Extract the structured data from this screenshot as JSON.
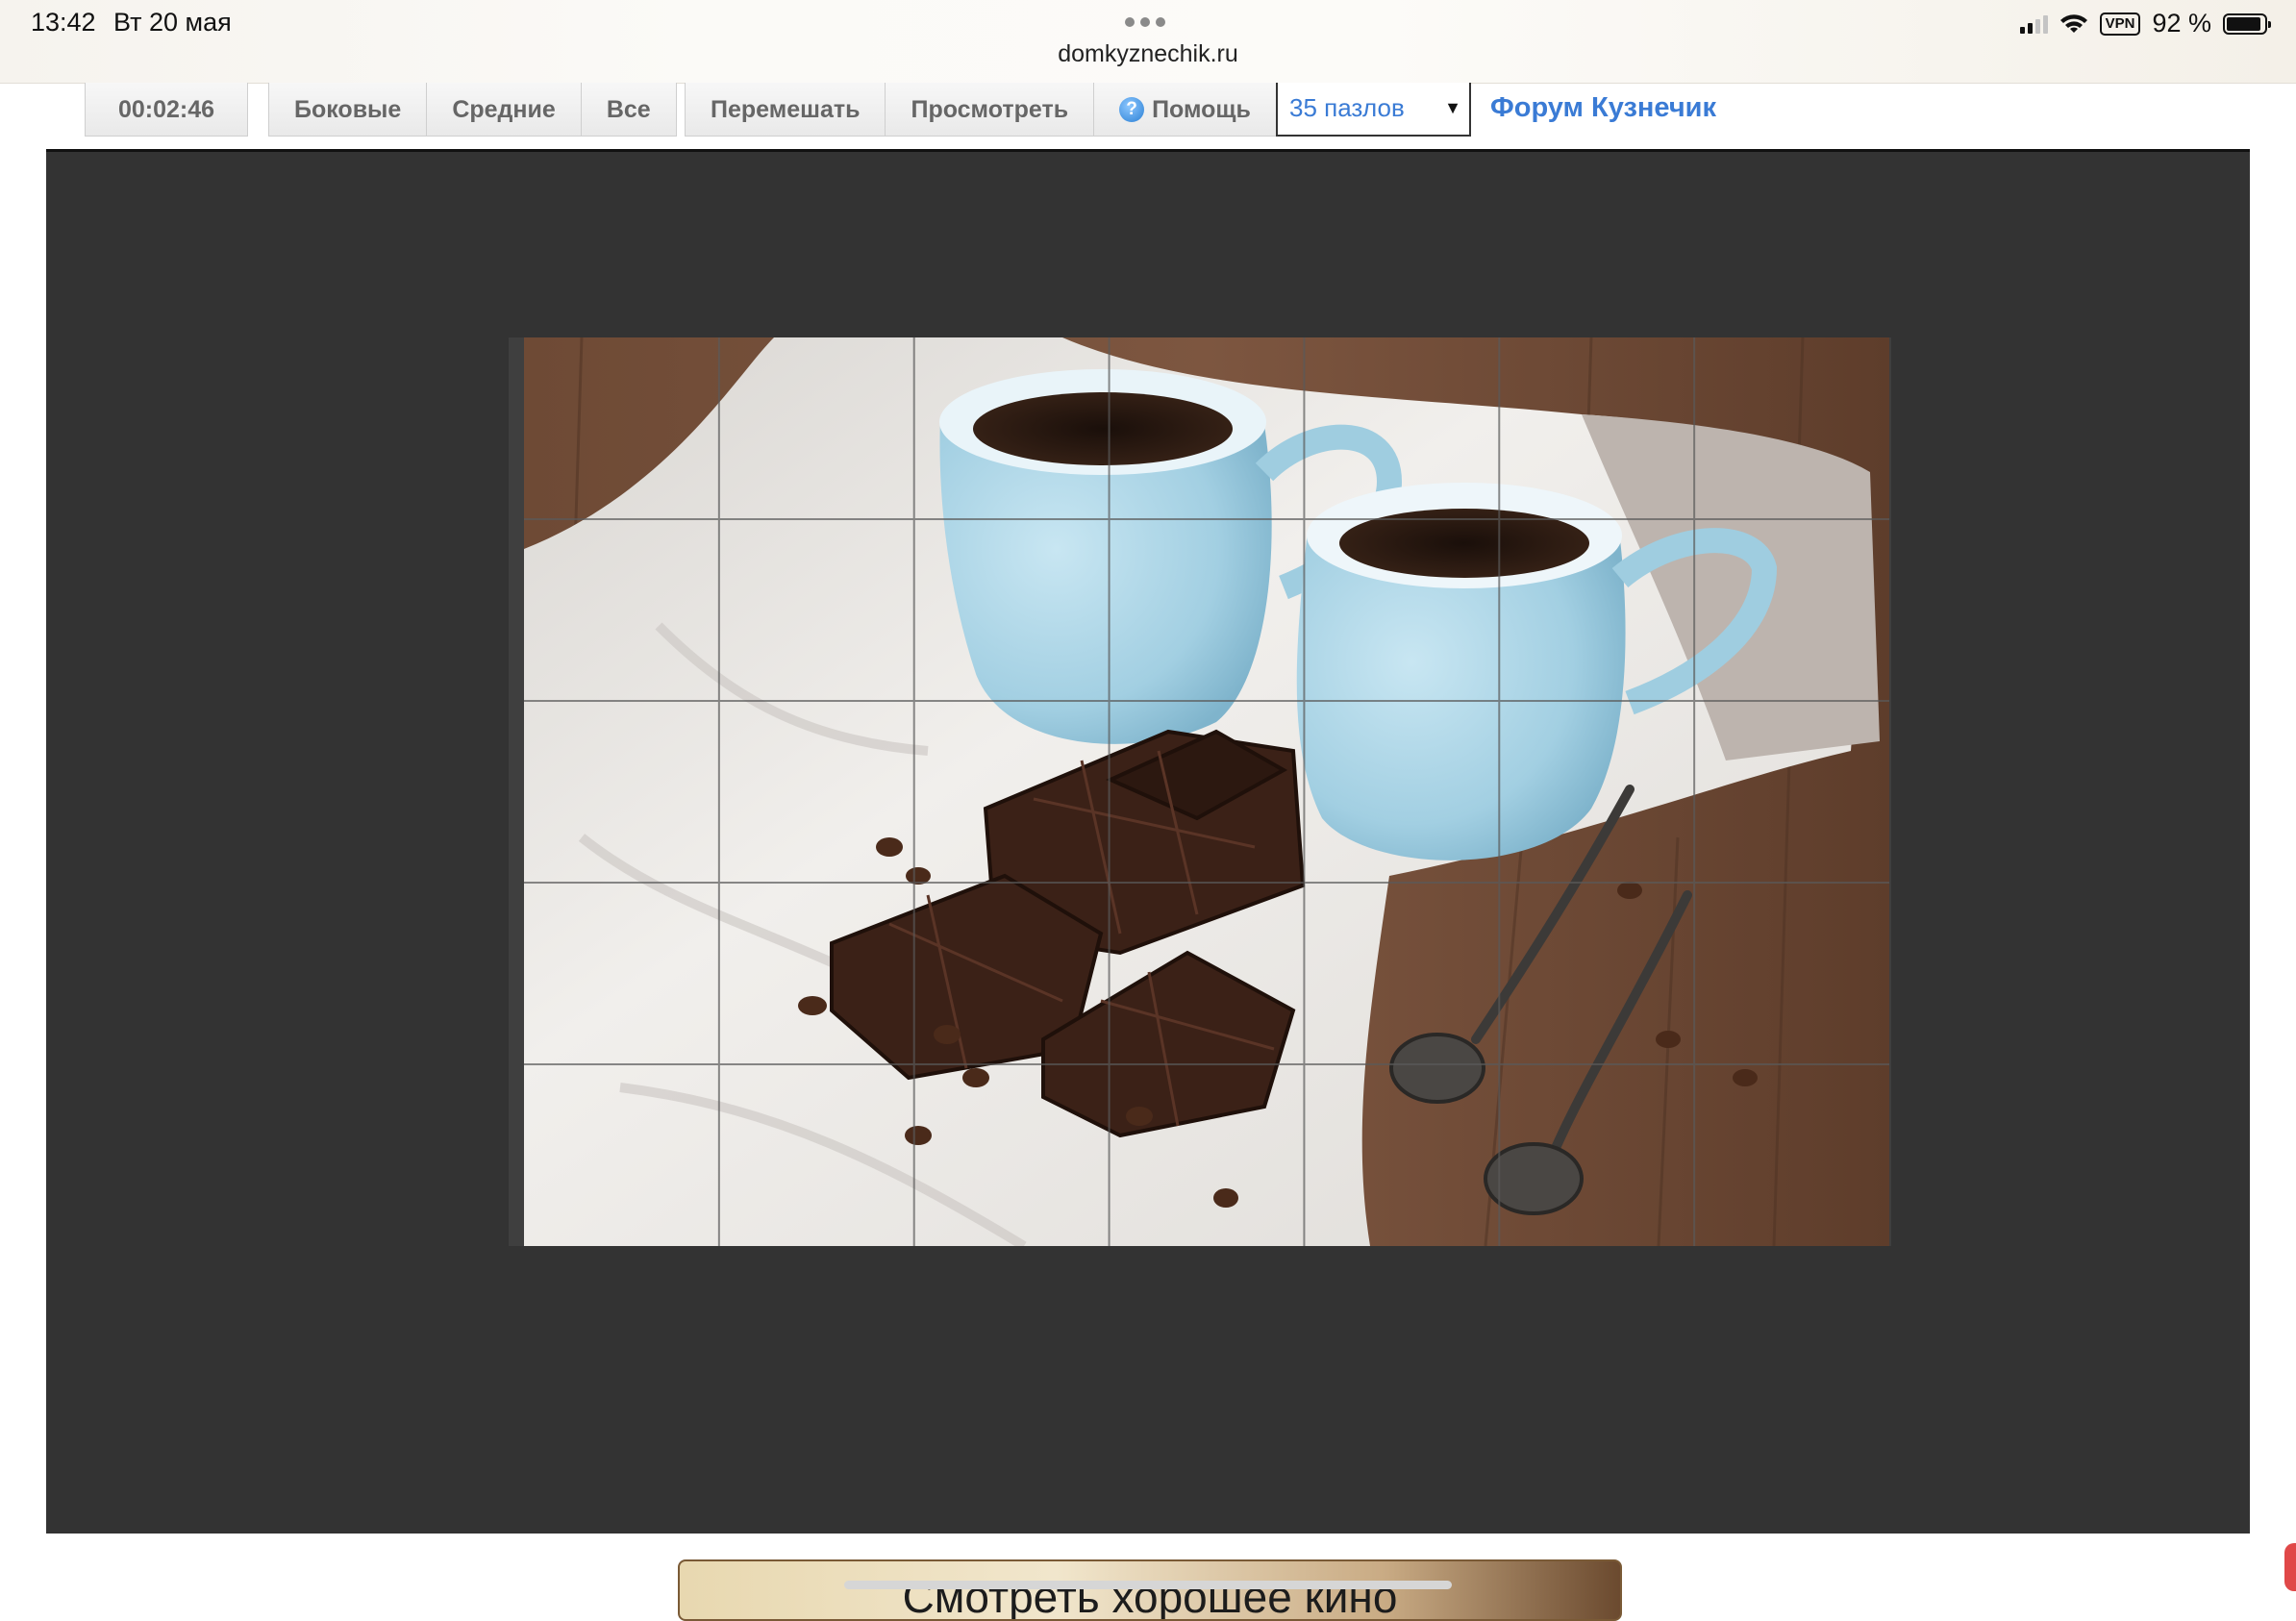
{
  "status_bar": {
    "time": "13:42",
    "date": "Вт 20 мая",
    "url": "domkyznechik.ru",
    "vpn": "VPN",
    "battery_percent": "92 %",
    "battery_level": 0.92
  },
  "toolbar": {
    "timer": "00:02:46",
    "edge_label": "Боковые",
    "middle_label": "Средние",
    "all_label": "Все",
    "shuffle_label": "Перемешать",
    "preview_label": "Просмотреть",
    "help_label": "Помощь",
    "pieces_select": "35 пазлов",
    "forum_link": "Форум Кузнечик"
  },
  "puzzle": {
    "rows": 5,
    "cols": 7,
    "image": "coffee-cups-chocolate-icon"
  },
  "promo": {
    "text": "Смотреть хорошее кино"
  },
  "colors": {
    "board": "#333333",
    "link": "#3a7bd5"
  }
}
